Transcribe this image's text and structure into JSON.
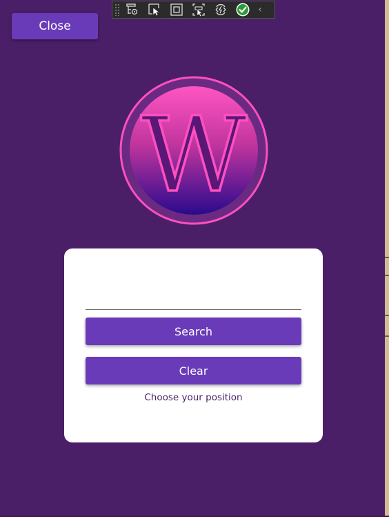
{
  "colors": {
    "page_background": "#4b1f68",
    "button_background": "#6a3bb8",
    "button_text": "#ffffff",
    "card_background": "#ffffff",
    "label_text": "#4b1f68",
    "logo_gradient_top": "#ff4fc0",
    "logo_gradient_bottom": "#2a0a8c",
    "logo_ring": "#ff4fc0"
  },
  "header": {
    "close_label": "Close"
  },
  "debug_toolbar": {
    "items": [
      {
        "icon": "live-visual-tree-icon"
      },
      {
        "icon": "select-element-icon"
      },
      {
        "icon": "display-layout-adorners-icon"
      },
      {
        "icon": "track-focus-icon"
      },
      {
        "icon": "hot-reload-icon"
      },
      {
        "icon": "binding-failures-ok-icon"
      }
    ],
    "collapse_icon": "chevron-left-icon"
  },
  "logo": {
    "letter": "W",
    "icon": "w-logo-icon"
  },
  "search_card": {
    "entry_value": "",
    "entry_placeholder": "",
    "search_label": "Search",
    "clear_label": "Clear",
    "position_label": "Choose your position"
  }
}
